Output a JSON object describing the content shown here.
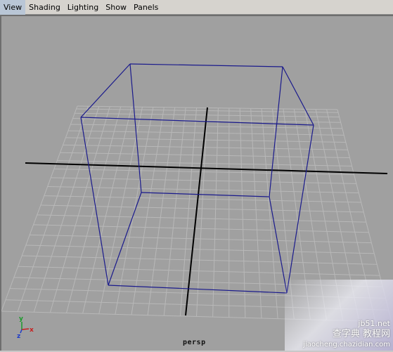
{
  "menubar": {
    "items": [
      "View",
      "Shading",
      "Lighting",
      "Show",
      "Panels"
    ]
  },
  "viewport": {
    "camera_name": "persp",
    "background_color": "#a0a0a0",
    "grid_color": "#b8b8b8",
    "axis_color": "#000000",
    "cube_color": "#1a1a8c"
  },
  "axis_gizmo": {
    "y_label": "y",
    "x_label": "x",
    "z_label": "z",
    "y_color": "#1a9a2a",
    "x_color": "#c81e1e",
    "z_color": "#1e3cc8"
  },
  "watermark": {
    "line1": "查字典 教程网",
    "line2": "jiaocheng.chazidian.com",
    "corner_text": "jb51.net"
  }
}
